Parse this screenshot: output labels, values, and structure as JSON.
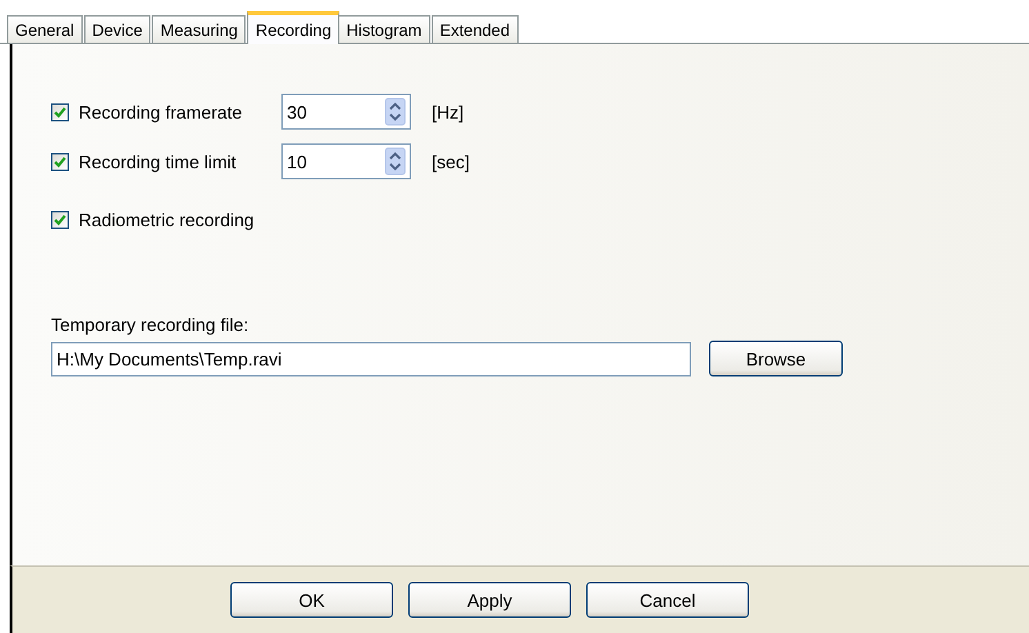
{
  "tabs": [
    {
      "label": "General",
      "selected": false
    },
    {
      "label": "Device",
      "selected": false
    },
    {
      "label": "Measuring",
      "selected": false
    },
    {
      "label": "Recording",
      "selected": true
    },
    {
      "label": "Histogram",
      "selected": false
    },
    {
      "label": "Extended",
      "selected": false
    }
  ],
  "settings": [
    {
      "kind": "spinner",
      "label": "Recording framerate",
      "checked": true,
      "value": "30",
      "unit": "[Hz]"
    },
    {
      "kind": "spinner",
      "label": "Recording time limit",
      "checked": true,
      "value": "10",
      "unit": "[sec]"
    },
    {
      "kind": "checkbox",
      "label": "Radiometric recording",
      "checked": true
    }
  ],
  "file": {
    "label": "Temporary recording file:",
    "value": "H:\\My Documents\\Temp.ravi",
    "button": "Browse"
  },
  "buttons": [
    "OK",
    "Apply",
    "Cancel"
  ]
}
